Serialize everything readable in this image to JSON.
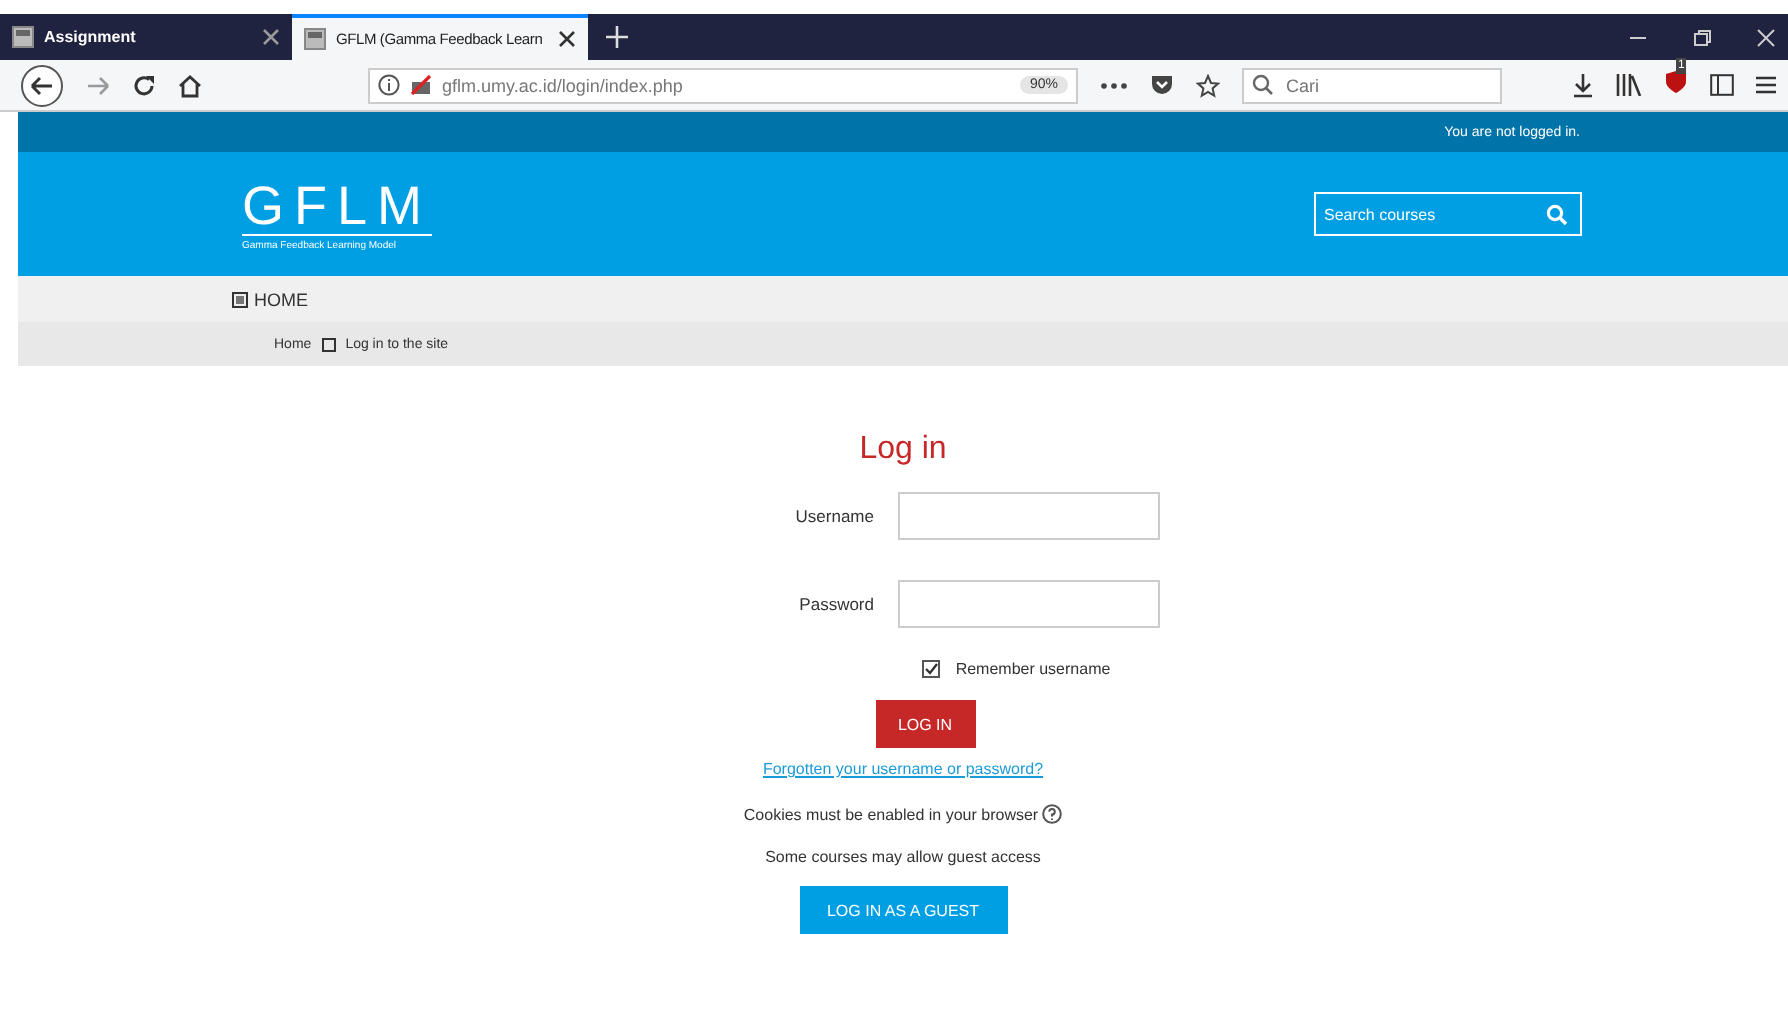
{
  "browser": {
    "tabs": [
      {
        "title": "Assignment",
        "selected": false
      },
      {
        "title": "GFLM (Gamma Feedback Learn",
        "selected": true
      }
    ],
    "url": "gflm.umy.ac.id/login/index.php",
    "zoom": "90%",
    "search": {
      "placeholder": "Cari"
    },
    "badge": "1"
  },
  "topbar": {
    "status": "You are not logged in."
  },
  "header": {
    "logo": "GFLM",
    "tagline": "Gamma Feedback Learning Model",
    "search": {
      "placeholder": "Search courses"
    }
  },
  "nav": {
    "home": "HOME"
  },
  "breadcrumb": [
    "Home",
    "Log in to the site"
  ],
  "login": {
    "title": "Log in",
    "fields": [
      {
        "label": "Username"
      },
      {
        "label": "Password"
      }
    ],
    "remember": {
      "label": "Remember username",
      "checked": true
    },
    "submit": "LOG IN",
    "forgot": "Forgotten your username or password?",
    "cookies": "Cookies must be enabled in your browser",
    "guest_note": "Some courses may allow guest access",
    "guest_button": "LOG IN AS A GUEST"
  }
}
